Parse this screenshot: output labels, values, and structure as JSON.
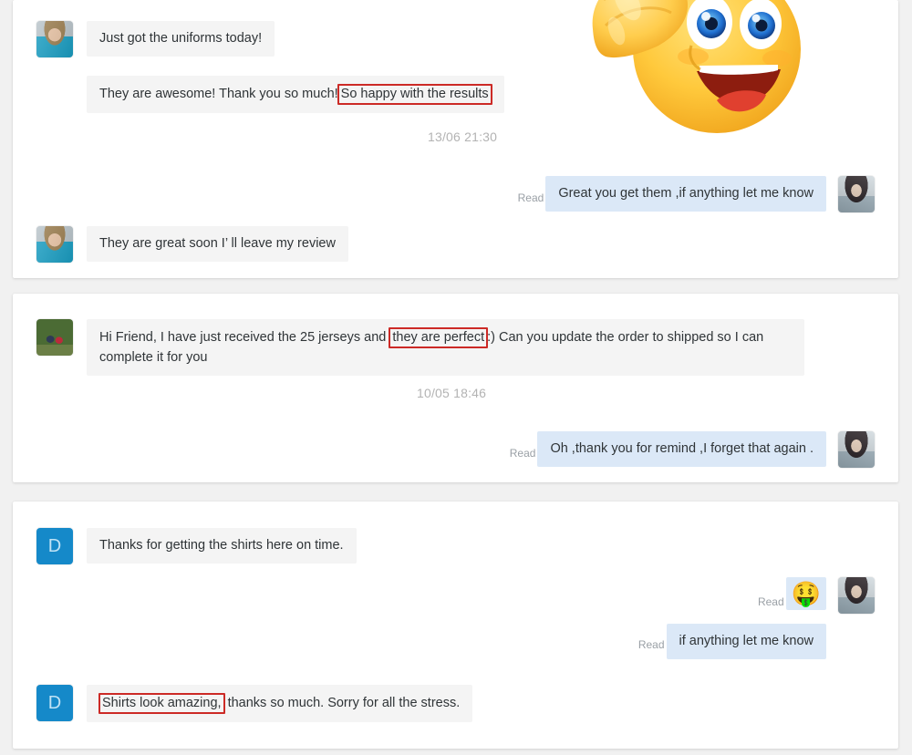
{
  "theme": {
    "page_background": "#f1f1f1",
    "card_background": "#ffffff",
    "incoming_bubble": "#f4f4f4",
    "outgoing_bubble": "#dbe8f7",
    "highlight_border": "#cc2a26",
    "avatar_initial_background": "#1589c9",
    "timestamp_color": "#b3b3b3",
    "read_label_color": "#9aa0a6"
  },
  "conversations": [
    {
      "id": "conversation-1",
      "messages": [
        {
          "direction": "incoming",
          "avatar": "photo-avatar-girl-blue-top",
          "text": "Just got the uniforms today!"
        },
        {
          "direction": "incoming",
          "avatar": "none",
          "text_before": "They are awesome! Thank you so much!",
          "highlight": "So happy with the results",
          "text_after": ""
        },
        {
          "direction": "sticker",
          "sticker": "thumbs-up-smiley-emoji"
        },
        {
          "direction": "outgoing",
          "read_label": "Read",
          "avatar": "photo-avatar-dark-haired-girl",
          "text": "Great you get them ,if anything let me know"
        },
        {
          "direction": "incoming",
          "avatar": "photo-avatar-girl-blue-top",
          "text": "They are great soon I’  ll leave my review"
        }
      ],
      "timestamp": "13/06 21:30"
    },
    {
      "id": "conversation-2",
      "messages": [
        {
          "direction": "incoming",
          "avatar": "photo-avatar-couple",
          "text_before": "Hi Friend, I have just received the 25 jerseys and ",
          "highlight": "they are perfect",
          "text_after": ":) Can you update the order to shipped so I can complete it for you"
        },
        {
          "direction": "outgoing",
          "read_label": "Read",
          "avatar": "photo-avatar-dark-haired-girl",
          "text": "Oh ,thank you for remind ,I forget that again ."
        }
      ],
      "timestamp": "10/05 18:46"
    },
    {
      "id": "conversation-3",
      "messages": [
        {
          "direction": "incoming",
          "avatar": "initial-avatar-d",
          "avatar_initial": "D",
          "text": "Thanks for getting the shirts here on time."
        },
        {
          "direction": "outgoing-sticker",
          "read_label": "Read",
          "avatar": "photo-avatar-dark-haired-girl",
          "sticker": "excited-money-face-emoji",
          "sticker_glyph": "🤑"
        },
        {
          "direction": "outgoing",
          "read_label": "Read",
          "text": "if anything let me know"
        },
        {
          "direction": "incoming",
          "avatar": "initial-avatar-d",
          "avatar_initial": "D",
          "highlight": "Shirts look amazing,",
          "text_after": " thanks so much. Sorry for all the stress."
        }
      ]
    }
  ]
}
